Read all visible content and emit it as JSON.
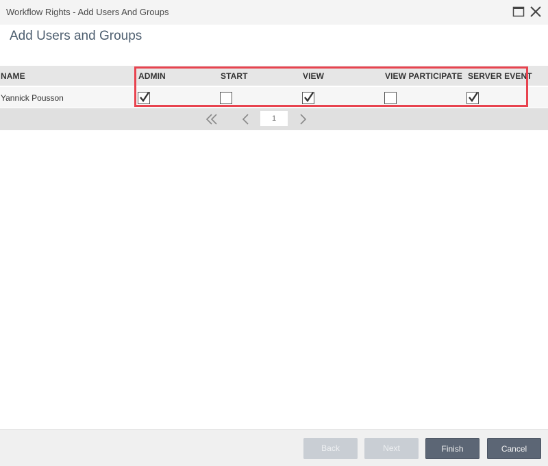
{
  "window": {
    "title": "Workflow Rights - Add Users And Groups",
    "maximize_icon": "maximize-icon",
    "close_icon": "close-icon"
  },
  "page": {
    "heading": "Add Users and Groups"
  },
  "grid": {
    "columns": [
      "NAME",
      "ADMIN",
      "START",
      "VIEW",
      "VIEW PARTICIPATE",
      "SERVER EVENT"
    ],
    "rows": [
      {
        "name": "Yannick Pousson",
        "admin": true,
        "start": false,
        "view": true,
        "view_participate": false,
        "server_event": true
      }
    ],
    "highlight_color": "#e8434f"
  },
  "pager": {
    "first_icon": "double-chevron-left-icon",
    "prev_icon": "chevron-left-icon",
    "next_icon": "chevron-right-icon",
    "current_page": "1"
  },
  "footer": {
    "back_label": "Back",
    "next_label": "Next",
    "finish_label": "Finish",
    "cancel_label": "Cancel"
  }
}
